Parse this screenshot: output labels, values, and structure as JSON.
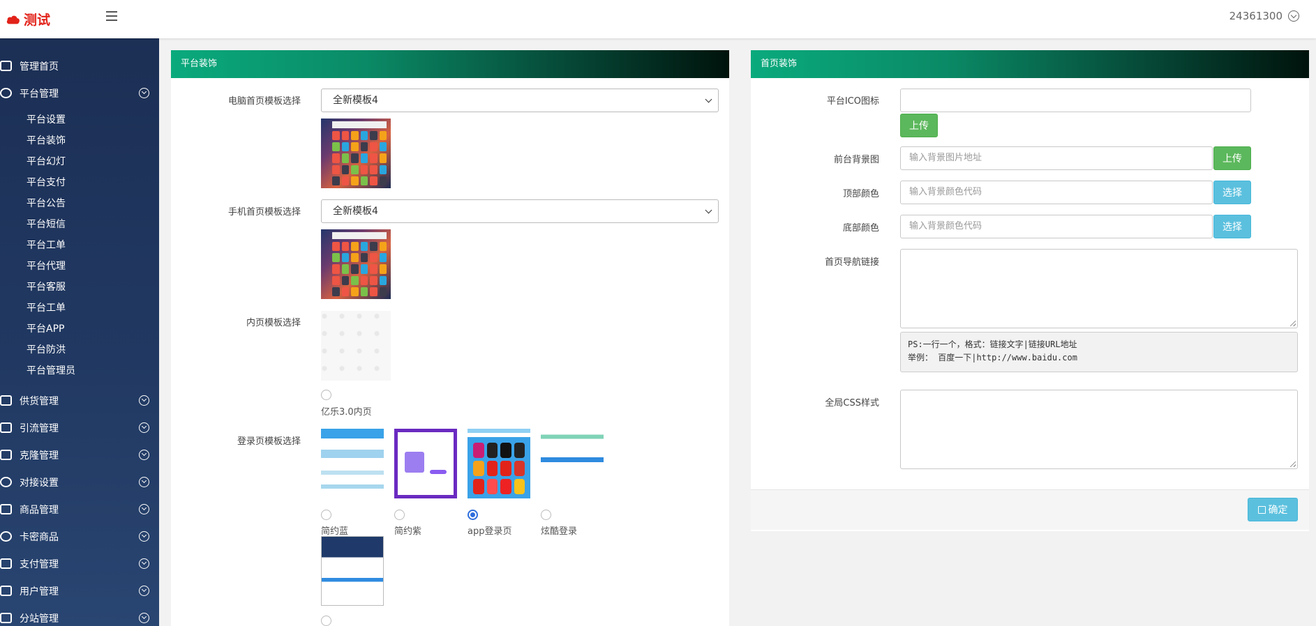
{
  "header": {
    "logo_text": "测试",
    "username": "24361300"
  },
  "sidebar": {
    "home": "管理首页",
    "platform": {
      "label": "平台管理",
      "children": [
        "平台设置",
        "平台装饰",
        "平台幻灯",
        "平台支付",
        "平台公告",
        "平台短信",
        "平台工单",
        "平台代理",
        "平台客服",
        "平台工单",
        "平台APP",
        "平台防洪",
        "平台管理员"
      ]
    },
    "groups": [
      "供货管理",
      "引流管理",
      "克隆管理",
      "对接设置",
      "商品管理",
      "卡密商品",
      "支付管理",
      "用户管理",
      "分站管理"
    ]
  },
  "left_panel": {
    "title": "平台装饰",
    "pc_template_label": "电脑首页模板选择",
    "pc_template_value": "全新模板4",
    "mobile_template_label": "手机首页模板选择",
    "mobile_template_value": "全新模板4",
    "inner_template_label": "内页模板选择",
    "inner_option": "亿乐3.0内页",
    "login_template_label": "登录页模板选择",
    "login_options": [
      "简约蓝",
      "简约紫",
      "app登录页",
      "炫酷登录"
    ],
    "login_selected": "app登录页"
  },
  "right_panel": {
    "title": "首页装饰",
    "ico_label": "平台ICO图标",
    "ico_value": "",
    "upload_label": "上传",
    "bg_image_label": "前台背景图",
    "bg_image_placeholder": "输入背景图片地址",
    "top_color_label": "顶部颜色",
    "top_color_placeholder": "输入背景颜色代码",
    "bottom_color_label": "底部颜色",
    "bottom_color_placeholder": "输入背景颜色代码",
    "choose_label": "选择",
    "nav_links_label": "首页导航链接",
    "nav_links_note_line1": "PS:一行一个，格式：链接文字|链接URL地址",
    "nav_links_note_line2": "举例： 百度一下|http://www.baidu.com",
    "css_label": "全局CSS样式",
    "confirm_label": "确定"
  },
  "colors": {
    "accent_green": "#0aaa7d",
    "sidebar_bg": "#1c2f55",
    "upload_green": "#5cb85c",
    "choose_blue": "#5bc0de",
    "logo_red": "#e2231a"
  }
}
